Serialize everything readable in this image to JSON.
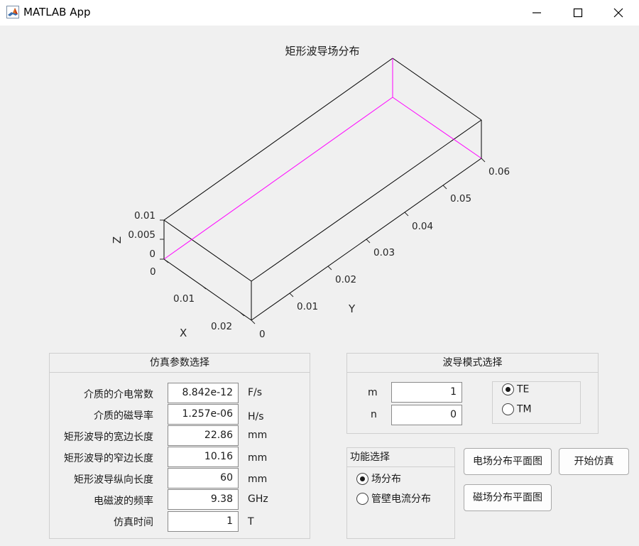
{
  "window": {
    "title": "MATLAB App",
    "icon": "matlab-membrane-icon"
  },
  "plot": {
    "title": "矩形波导场分布",
    "xlabel": "X",
    "ylabel": "Y",
    "zlabel": "Z",
    "x_ticks": [
      "0",
      "0.01",
      "0.02"
    ],
    "y_ticks": [
      "0",
      "0.01",
      "0.02",
      "0.03",
      "0.04",
      "0.05",
      "0.06"
    ],
    "z_ticks": [
      "0",
      "0.005",
      "0.01"
    ],
    "box_edge_color": "#000000",
    "field_line_color": "#ff00ff"
  },
  "chart_data": {
    "type": "3d-box",
    "title": "矩形波导场分布",
    "xlabel": "X",
    "ylabel": "Y",
    "zlabel": "Z",
    "xlim": [
      0,
      0.02286
    ],
    "ylim": [
      0,
      0.06
    ],
    "zlim": [
      0,
      0.01016
    ],
    "field_line": {
      "color": "#ff00ff",
      "x": 0,
      "z": [
        0,
        0.01016
      ]
    }
  },
  "params_panel": {
    "title": "仿真参数选择",
    "rows": [
      {
        "label": "介质的介电常数",
        "value": "8.842e-12",
        "unit": "F/s"
      },
      {
        "label": "介质的磁导率",
        "value": "1.257e-06",
        "unit": "H/s"
      },
      {
        "label": "矩形波导的宽边长度",
        "value": "22.86",
        "unit": "mm"
      },
      {
        "label": "矩形波导的窄边长度",
        "value": "10.16",
        "unit": "mm"
      },
      {
        "label": "矩形波导纵向长度",
        "value": "60",
        "unit": "mm"
      },
      {
        "label": "电磁波的频率",
        "value": "9.38",
        "unit": "GHz"
      },
      {
        "label": "仿真时间",
        "value": "1",
        "unit": "T"
      }
    ]
  },
  "mode_panel": {
    "title": "波导模式选择",
    "m_label": "m",
    "m_value": "1",
    "n_label": "n",
    "n_value": "0",
    "te_label": "TE",
    "tm_label": "TM",
    "selected": "TE"
  },
  "function_panel": {
    "title": "功能选择",
    "opt1": "场分布",
    "opt2": "管壁电流分布",
    "selected": "场分布"
  },
  "buttons": {
    "e_field": "电场分布平面图",
    "h_field": "磁场分布平面图",
    "start": "开始仿真"
  }
}
